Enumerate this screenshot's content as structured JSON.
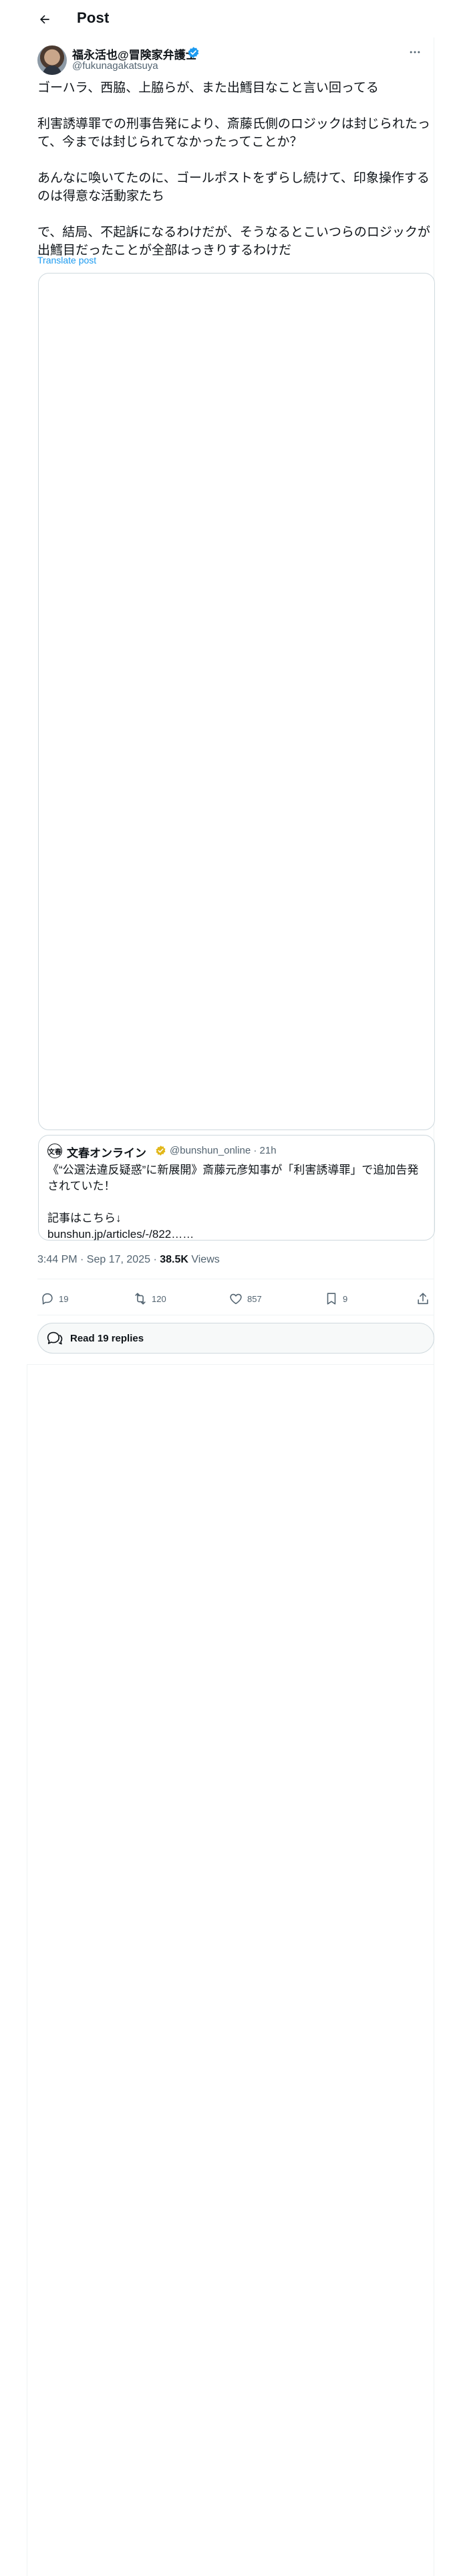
{
  "header": {
    "title": "Post"
  },
  "author": {
    "name": "福永活也@冒険家弁護士",
    "handle": "@fukunagakatsuya"
  },
  "tweet": {
    "text": "ゴーハラ、西脇、上脇らが、また出鱈目なこと言い回ってる\n\n利害誘導罪での刑事告発により、斎藤氏側のロジックは封じられたって、今までは封じられてなかったってことか？\n\nあんなに喚いてたのに、ゴールポストをずらし続けて、印象操作するのは得意な活動家たち\n\nで、結局、不起訴になるわけだが、そうなるとこいつらのロジックが出鱈目だったことが全部はっきりするわけだ",
    "translate_label": "Translate post"
  },
  "quote": {
    "avatar_text": "文春",
    "name": "文春オンライン",
    "handle": "@bunshun_online",
    "time": "21h",
    "text": "《“公選法違反疑惑”に新展開》斎藤元彦知事が「利害誘導罪」で追加告発されていた！\n\n記事はこちら↓\nbunshun.jp/articles/-/822……"
  },
  "meta": {
    "time": "3:44 PM · Sep 17, 2025 · ",
    "views_count": "38.5K",
    "views_label": " Views"
  },
  "actions": {
    "replies": "19",
    "reposts": "120",
    "likes": "857",
    "bookmarks": "9"
  },
  "read_replies_label": "Read 19 replies",
  "colors": {
    "accent": "#1d9bf0",
    "text": "#0f1419",
    "muted": "#536471",
    "border": "#cfd9de"
  },
  "icons": [
    "back-arrow-icon",
    "verified-badge-icon",
    "more-icon",
    "gold-badge-icon",
    "reply-icon",
    "repost-icon",
    "like-icon",
    "bookmark-icon",
    "share-icon",
    "replies-bubble-icon"
  ]
}
